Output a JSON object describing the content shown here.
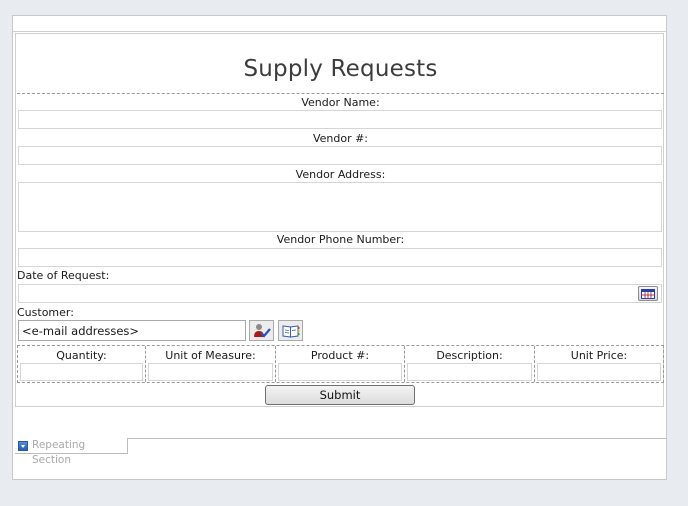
{
  "form": {
    "title": "Supply Requests",
    "fields": {
      "vendor_name": {
        "label": "Vendor Name:",
        "value": ""
      },
      "vendor_number": {
        "label": "Vendor #:",
        "value": ""
      },
      "vendor_address": {
        "label": "Vendor Address:",
        "value": ""
      },
      "vendor_phone": {
        "label": "Vendor Phone Number:",
        "value": ""
      },
      "date_of_request": {
        "label": "Date of Request:",
        "value": ""
      },
      "customer": {
        "label": "Customer:",
        "value": "<e-mail addresses>"
      }
    },
    "icons": {
      "calendar": "calendar-icon",
      "check_names": "check-names-icon",
      "address_book": "address-book-icon"
    },
    "table": {
      "columns": [
        "Quantity:",
        "Unit of Measure:",
        "Product #:",
        "Description:",
        "Unit Price:"
      ],
      "rows": [
        [
          "",
          "",
          "",
          "",
          ""
        ]
      ]
    },
    "submit_label": "Submit"
  },
  "repeating_section": {
    "label": "Repeating Section"
  }
}
